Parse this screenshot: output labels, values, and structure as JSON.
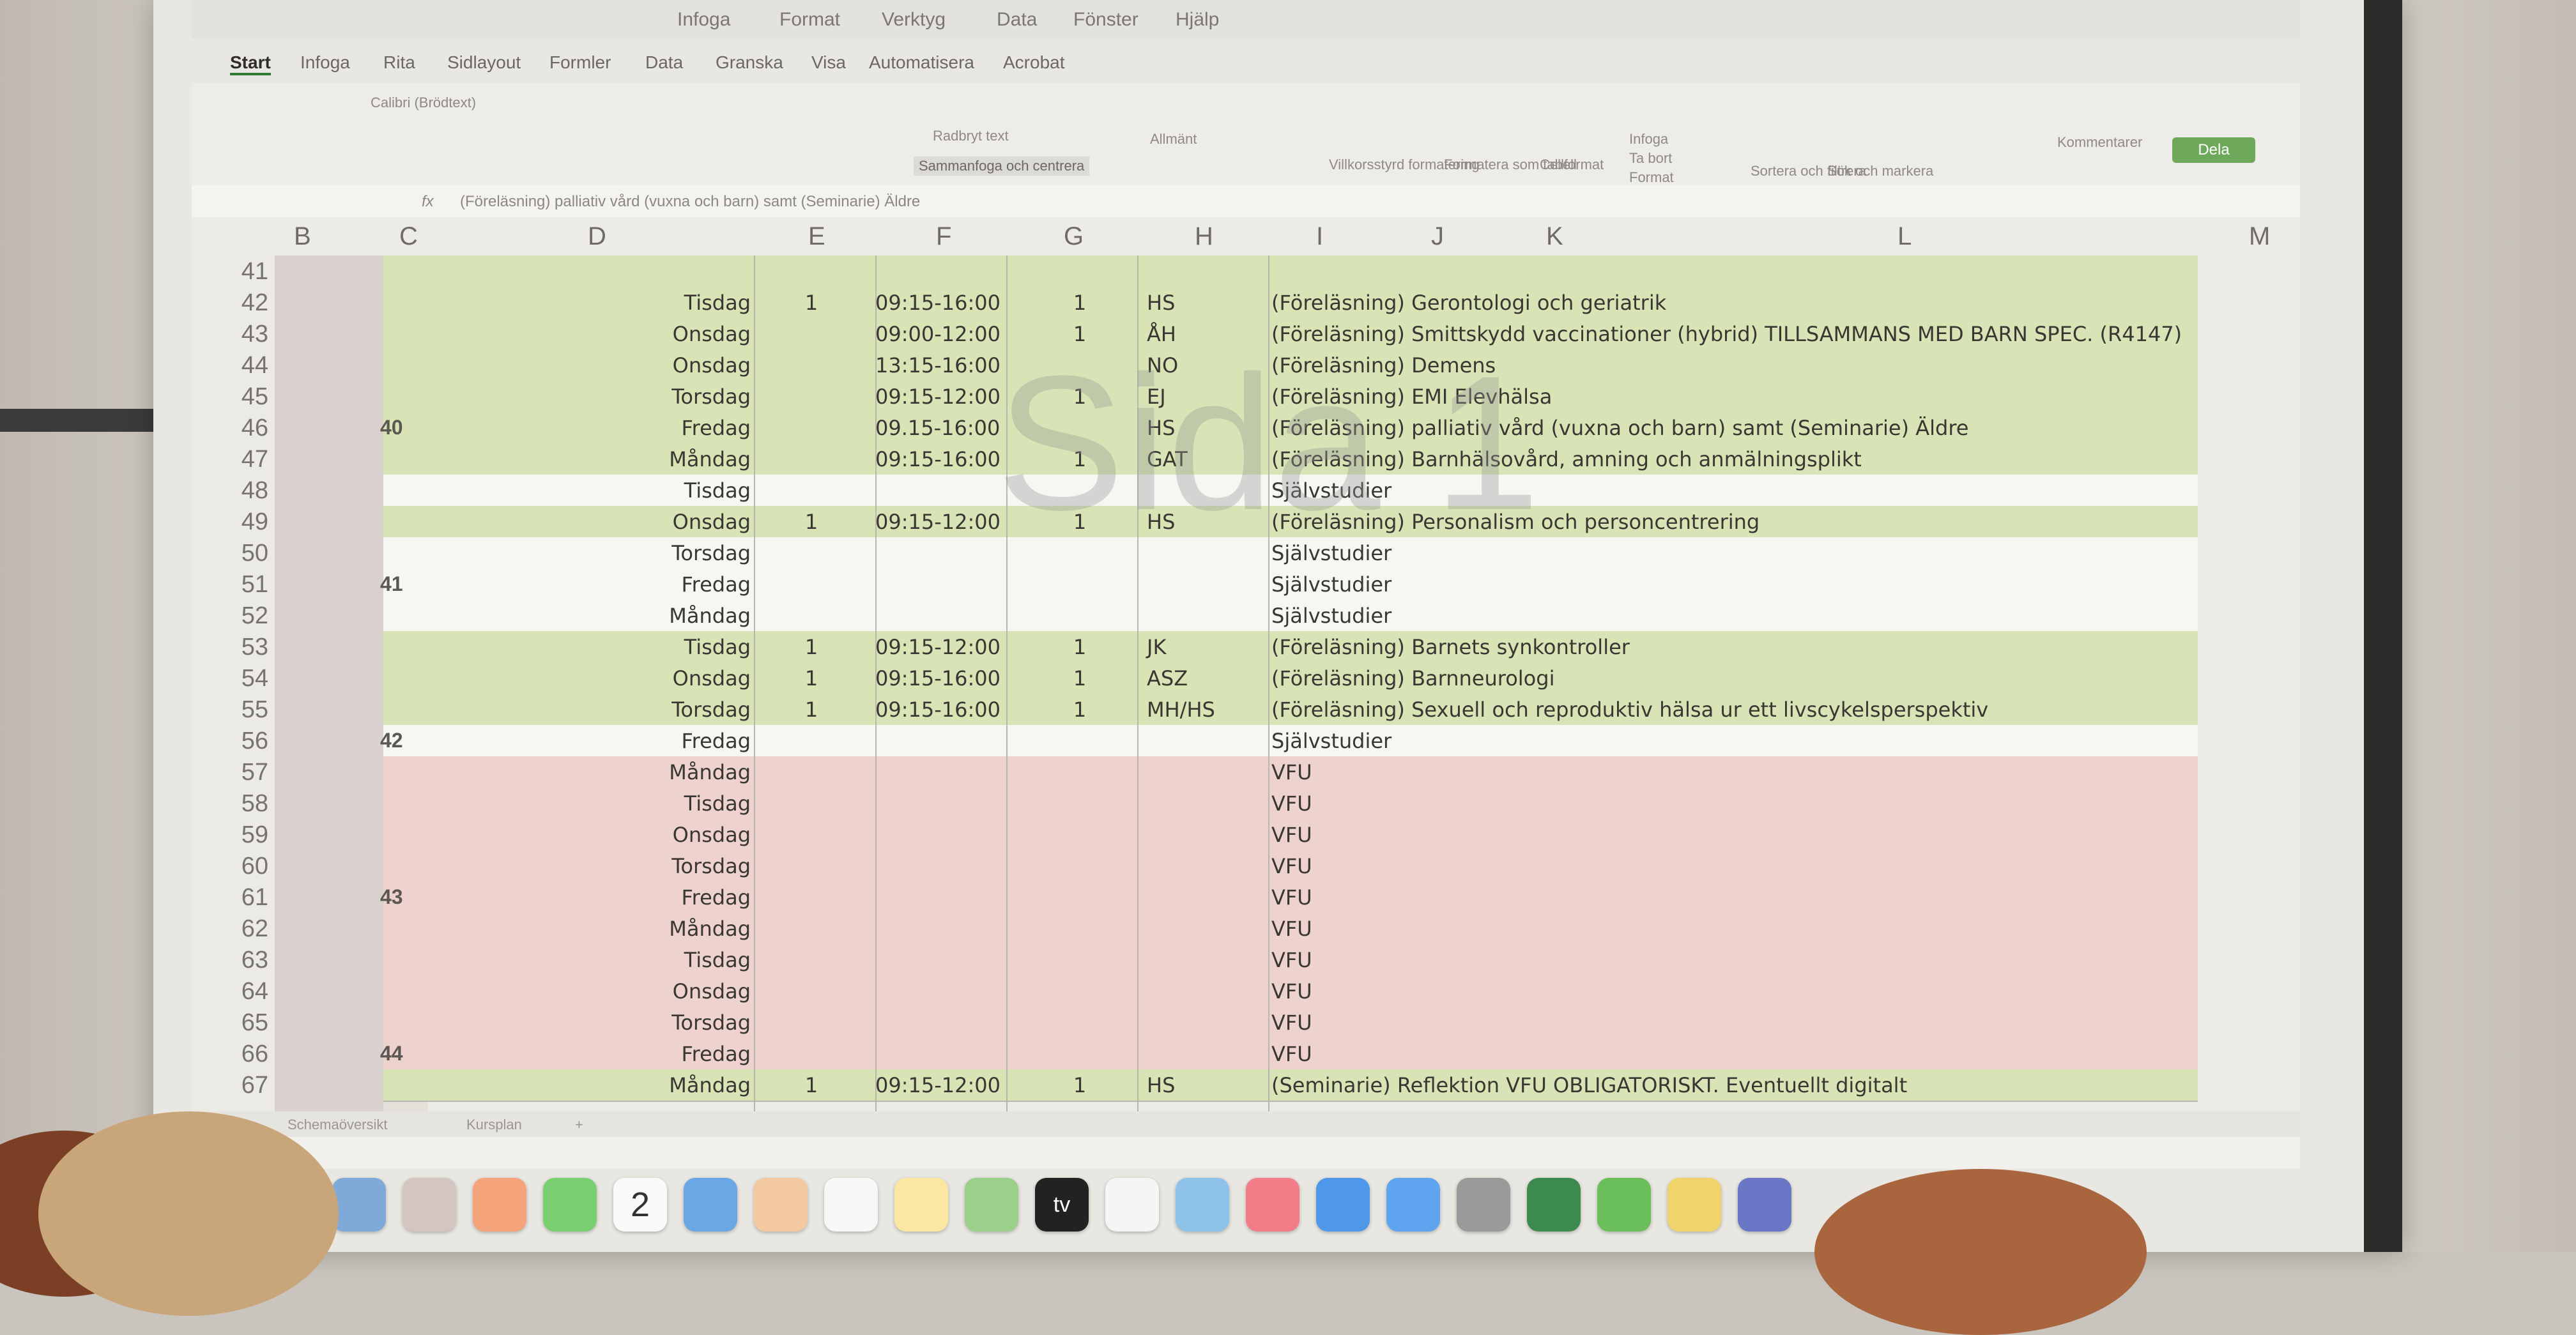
{
  "menubar": {
    "items": [
      "Infoga",
      "Format",
      "Verktyg",
      "Data",
      "Fönster",
      "Hjälp"
    ]
  },
  "ribbon": {
    "tabs": [
      "Start",
      "Infoga",
      "Rita",
      "Sidlayout",
      "Formler",
      "Data",
      "Granska",
      "Visa",
      "Automatisera",
      "Acrobat"
    ],
    "active_tab": "Start",
    "font_name": "Calibri (Brödtext)",
    "wrap_text": "Radbryt text",
    "merge_center": "Sammanfoga och centrera",
    "number_format": "Allmänt",
    "conditional_format": "Villkorsstyrd formatering",
    "format_as_table": "Formatera som tabell",
    "cell_styles": "Cellformat",
    "insert": "Infoga",
    "delete": "Ta bort",
    "format": "Format",
    "sort_filter": "Sortera och filtrera",
    "find_select": "Sök och markera",
    "comments": "Kommentarer",
    "share_label": "Dela"
  },
  "formula_bar": {
    "fx": "fx",
    "content": "(Föreläsning) palliativ vård (vuxna och barn) samt (Seminarie) Äldre"
  },
  "columns": [
    "B",
    "C",
    "D",
    "E",
    "F",
    "G",
    "H",
    "I",
    "J",
    "K",
    "L",
    "M"
  ],
  "watermark": "Sida 1",
  "week_labels": [
    {
      "row": 46,
      "week": "40"
    },
    {
      "row": 51,
      "week": "41"
    },
    {
      "row": 56,
      "week": "42"
    },
    {
      "row": 61,
      "week": "43"
    },
    {
      "row": 66,
      "week": "44"
    }
  ],
  "rows": [
    {
      "num": "41",
      "day": "",
      "e": "",
      "f": "",
      "g": "",
      "h": "",
      "l": "",
      "color": "green"
    },
    {
      "num": "42",
      "day": "Tisdag",
      "e": "1",
      "f": "09:15-16:00",
      "g": "1",
      "h": "HS",
      "l": "(Föreläsning) Gerontologi och geriatrik",
      "color": "green"
    },
    {
      "num": "43",
      "day": "Onsdag",
      "e": "",
      "f": "09:00-12:00",
      "g": "1",
      "h": "ÅH",
      "l": "(Föreläsning) Smittskydd vaccinationer (hybrid) TILLSAMMANS MED BARN SPEC. (R4147)",
      "color": "green"
    },
    {
      "num": "44",
      "day": "Onsdag",
      "e": "",
      "f": "13:15-16:00",
      "g": "",
      "h": "NO",
      "l": "(Föreläsning) Demens",
      "color": "green"
    },
    {
      "num": "45",
      "day": "Torsdag",
      "e": "",
      "f": "09:15-12:00",
      "g": "1",
      "h": "EJ",
      "l": "(Föreläsning) EMI Elevhälsa",
      "color": "green"
    },
    {
      "num": "46",
      "day": "Fredag",
      "e": "",
      "f": "09.15-16:00",
      "g": "",
      "h": "HS",
      "l": "(Föreläsning) palliativ vård (vuxna och barn) samt (Seminarie) Äldre",
      "color": "green"
    },
    {
      "num": "47",
      "day": "Måndag",
      "e": "",
      "f": "09:15-16:00",
      "g": "1",
      "h": "GAT",
      "l": "(Föreläsning) Barnhälsovård, amning och anmälningsplikt",
      "color": "green"
    },
    {
      "num": "48",
      "day": "Tisdag",
      "e": "",
      "f": "",
      "g": "",
      "h": "",
      "l": "Självstudier",
      "color": "white"
    },
    {
      "num": "49",
      "day": "Onsdag",
      "e": "1",
      "f": "09:15-12:00",
      "g": "1",
      "h": "HS",
      "l": "(Föreläsning) Personalism och personcentrering",
      "color": "green"
    },
    {
      "num": "50",
      "day": "Torsdag",
      "e": "",
      "f": "",
      "g": "",
      "h": "",
      "l": "Självstudier",
      "color": "white"
    },
    {
      "num": "51",
      "day": "Fredag",
      "e": "",
      "f": "",
      "g": "",
      "h": "",
      "l": "Självstudier",
      "color": "white"
    },
    {
      "num": "52",
      "day": "Måndag",
      "e": "",
      "f": "",
      "g": "",
      "h": "",
      "l": "Självstudier",
      "color": "white"
    },
    {
      "num": "53",
      "day": "Tisdag",
      "e": "1",
      "f": "09:15-12:00",
      "g": "1",
      "h": "JK",
      "l": "(Föreläsning) Barnets synkontroller",
      "color": "green"
    },
    {
      "num": "54",
      "day": "Onsdag",
      "e": "1",
      "f": "09:15-16:00",
      "g": "1",
      "h": "ASZ",
      "l": "(Föreläsning) Barnneurologi",
      "color": "green"
    },
    {
      "num": "55",
      "day": "Torsdag",
      "e": "1",
      "f": "09:15-16:00",
      "g": "1",
      "h": "MH/HS",
      "l": "(Föreläsning) Sexuell och reproduktiv hälsa ur ett livscykelsperspektiv",
      "color": "green"
    },
    {
      "num": "56",
      "day": "Fredag",
      "e": "",
      "f": "",
      "g": "",
      "h": "",
      "l": "Självstudier",
      "color": "white"
    },
    {
      "num": "57",
      "day": "Måndag",
      "e": "",
      "f": "",
      "g": "",
      "h": "",
      "l": "VFU",
      "color": "red"
    },
    {
      "num": "58",
      "day": "Tisdag",
      "e": "",
      "f": "",
      "g": "",
      "h": "",
      "l": "VFU",
      "color": "red"
    },
    {
      "num": "59",
      "day": "Onsdag",
      "e": "",
      "f": "",
      "g": "",
      "h": "",
      "l": "VFU",
      "color": "red"
    },
    {
      "num": "60",
      "day": "Torsdag",
      "e": "",
      "f": "",
      "g": "",
      "h": "",
      "l": "VFU",
      "color": "red"
    },
    {
      "num": "61",
      "day": "Fredag",
      "e": "",
      "f": "",
      "g": "",
      "h": "",
      "l": "VFU",
      "color": "red"
    },
    {
      "num": "62",
      "day": "Måndag",
      "e": "",
      "f": "",
      "g": "",
      "h": "",
      "l": "VFU",
      "color": "red"
    },
    {
      "num": "63",
      "day": "Tisdag",
      "e": "",
      "f": "",
      "g": "",
      "h": "",
      "l": "VFU",
      "color": "red"
    },
    {
      "num": "64",
      "day": "Onsdag",
      "e": "",
      "f": "",
      "g": "",
      "h": "",
      "l": "VFU",
      "color": "red"
    },
    {
      "num": "65",
      "day": "Torsdag",
      "e": "",
      "f": "",
      "g": "",
      "h": "",
      "l": "VFU",
      "color": "red"
    },
    {
      "num": "66",
      "day": "Fredag",
      "e": "",
      "f": "",
      "g": "",
      "h": "",
      "l": "VFU",
      "color": "red"
    },
    {
      "num": "67",
      "day": "Måndag",
      "e": "1",
      "f": "09:15-12:00",
      "g": "1",
      "h": "HS",
      "l": "(Seminarie) Reflektion VFU OBLIGATORISKT. Eventuellt digitalt",
      "color": "green"
    }
  ],
  "sheet_tabs": [
    "Schemaöversikt",
    "Kursplan"
  ],
  "dock": {
    "icons": [
      "finder-icon",
      "launchpad-icon",
      "photos-icon",
      "facetime-icon",
      "calendar-icon",
      "safari-icon",
      "messages-icon",
      "reminders-icon",
      "notes-icon",
      "maps-icon",
      "appletv-icon",
      "podcasts-icon",
      "keynote-icon",
      "music-icon",
      "files-icon",
      "appstore-icon",
      "settings-icon",
      "excel-icon",
      "lock-icon",
      "chrome-icon",
      "teams-icon"
    ],
    "calendar_day": "2",
    "appletv_label": "tv"
  },
  "colors": {
    "green_row": "#d8e4b5",
    "white_row": "#f6f6f3",
    "red_row": "#eed2cd",
    "accent": "#2f7d32"
  }
}
